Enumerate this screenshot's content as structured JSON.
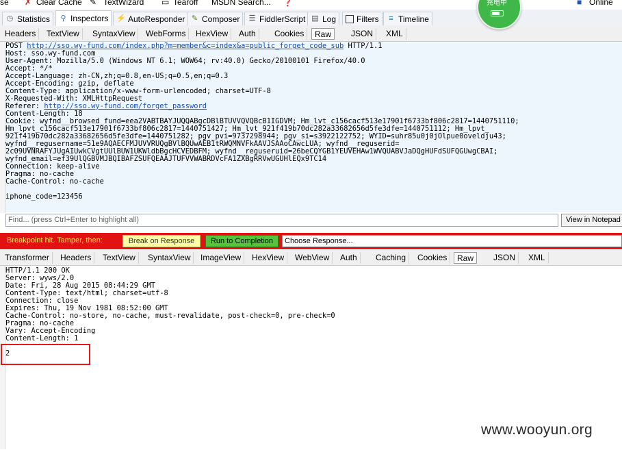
{
  "top_toolbar": {
    "partial_left": "se",
    "clear_cache": "Clear Cache",
    "textwizard": "TextWizard",
    "tearoff": "Tearoff",
    "msdn_search": "MSDN Search...",
    "online": "Online"
  },
  "main_tabs": [
    {
      "label": "Statistics",
      "icon": "clock-icon"
    },
    {
      "label": "Inspectors",
      "icon": "magnifier-icon"
    },
    {
      "label": "AutoResponder",
      "icon": "lightning-icon"
    },
    {
      "label": "Composer",
      "icon": "pencil-icon"
    },
    {
      "label": "FiddlerScript",
      "icon": "script-icon"
    },
    {
      "label": "Log",
      "icon": "log-icon"
    },
    {
      "label": "Filters",
      "icon": "checkbox-icon"
    },
    {
      "label": "Timeline",
      "icon": "timeline-icon"
    }
  ],
  "request_tabs": [
    "Headers",
    "TextView",
    "SyntaxView",
    "WebForms",
    "HexView",
    "Auth",
    "Cookies",
    "Raw",
    "JSON",
    "XML"
  ],
  "request": {
    "method": "POST ",
    "url": "http://sso.wy-fund.com/index.php?m=member&c=index&a=public_forget_code_sub",
    "protocol": " HTTP/1.1",
    "lines_a": "Host: sso.wy-fund.com\nUser-Agent: Mozilla/5.0 (Windows NT 6.1; WOW64; rv:40.0) Gecko/20100101 Firefox/40.0\nAccept: */*\nAccept-Language: zh-CN,zh;q=0.8,en-US;q=0.5,en;q=0.3\nAccept-Encoding: gzip, deflate\nContent-Type: application/x-www-form-urlencoded; charset=UTF-8\nX-Requested-With: XMLHttpRequest",
    "referer_label": "Referer: ",
    "referer_url": "http://sso.wy-fund.com/forget_password",
    "lines_b": "Content-Length: 18\nCookie: wyfnd__browsed_fund=eea2VABTBAYJUQQABgcDBlBTUVVQVQBcB1IGDVM; Hm_lvt_c156cacf513e17901f6733bf806c2817=1440751110;\nHm_lpvt_c156cacf513e17901f6733bf806c2817=1440751427; Hm_lvt_921f419b70dc282a33682656d5fe3dfe=1440751112; Hm_lpvt_\n921f419b70dc282a33682656d5fe3dfe=1440751282; pgv_pvi=9737298944; pgv_si=s3922122752; WYID=suhr85u0j0jOlpue0oveldju43;\nwyfnd__regusername=51e9AQAECFMJUVVRUQgBVlBQUwAEB1tRWQMNVFkAAVJSAAoCAwcLUA; wyfnd__reguserid=\n2c09UVNRAFYJUgAIUwkCVgtUUlBUW1UKWldbBgcHCVEDBFM; wyfnd__reguseruid=26beCQYGB1YEUVEHAw1WVQUABVJaDQgHUFdSUFQGUwgCBAI;\nwyfnd_email=ef39UlQGBVMJBQIBAFZSUFQEAAJTUFVVWABRDVcFA1ZXBgRRVwUGUHlEQx9TC14\nConnection: keep-alive\nPragma: no-cache\nCache-Control: no-cache\n\niphone_code=123456"
  },
  "find_placeholder": "Find... (press Ctrl+Enter to highlight all)",
  "view_in_notepad": "View in Notepad",
  "breakpoint": {
    "label": "Breakpoint hit. Tamper, then:",
    "break_on_response": "Break on Response",
    "run_to_completion": "Run to Completion",
    "choose_response": "Choose Response..."
  },
  "response_tabs": [
    "Transformer",
    "Headers",
    "TextView",
    "SyntaxView",
    "ImageView",
    "HexView",
    "WebView",
    "Auth",
    "Caching",
    "Cookies",
    "Raw",
    "JSON",
    "XML"
  ],
  "response": {
    "text": "HTTP/1.1 200 OK\nServer: wyws/2.0\nDate: Fri, 28 Aug 2015 08:44:29 GMT\nContent-Type: text/html; charset=utf-8\nConnection: close\nExpires: Thu, 19 Nov 1981 08:52:00 GMT\nCache-Control: no-store, no-cache, must-revalidate, post-check=0, pre-check=0\nPragma: no-cache\nVary: Accept-Encoding\nContent-Length: 1\n\n2"
  },
  "overlay": {
    "badge_text": "充电中"
  },
  "watermark": "www.wooyun.org",
  "colors": {
    "breakpoint_bar": "#e21212",
    "run_button": "#55c43a",
    "break_button": "#ffffa5",
    "link": "#1a4fb5",
    "highlight": "#e21a1a"
  }
}
